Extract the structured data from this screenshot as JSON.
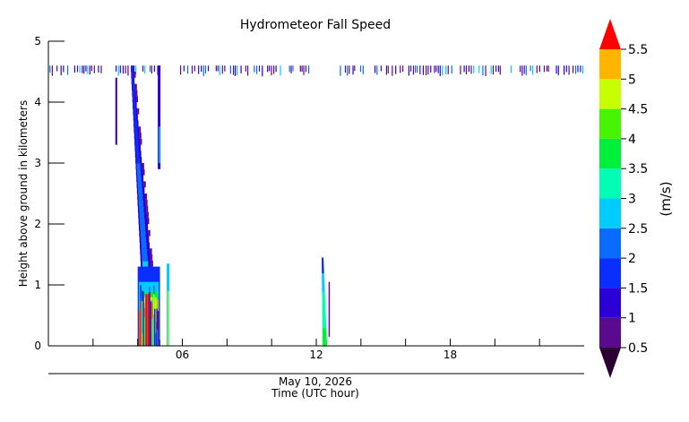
{
  "chart_data": {
    "type": "heatmap",
    "title": "Hydrometeor Fall Speed",
    "ylabel": "Height above ground in kilometers",
    "xlabel": "Time (UTC hour)",
    "date_label": "May 10, 2026",
    "colorbar_label": "(m/s)",
    "xlim": [
      0,
      24
    ],
    "ylim": [
      0,
      5
    ],
    "x_ticks": [
      {
        "value": 6,
        "label": "06"
      },
      {
        "value": 12,
        "label": "12"
      },
      {
        "value": 18,
        "label": "18"
      }
    ],
    "x_minor_ticks": [
      2,
      4,
      8,
      10,
      14,
      16,
      20,
      22
    ],
    "y_ticks": [
      {
        "value": 0,
        "label": "0"
      },
      {
        "value": 1,
        "label": "1"
      },
      {
        "value": 2,
        "label": "2"
      },
      {
        "value": 3,
        "label": "3"
      },
      {
        "value": 4,
        "label": "4"
      },
      {
        "value": 5,
        "label": "5"
      }
    ],
    "colorbar": {
      "levels": [
        0.5,
        1,
        1.5,
        2,
        2.5,
        3,
        3.5,
        4,
        4.5,
        5,
        5.5
      ],
      "labels": [
        "0.5",
        "1",
        "1.5",
        "2",
        "2.5",
        "3",
        "3.5",
        "4",
        "4.5",
        "5",
        "5.5"
      ],
      "colors": [
        "#5a0a8c",
        "#2a00d6",
        "#0a2eff",
        "#0a6cff",
        "#00ccff",
        "#00ffb4",
        "#00f03c",
        "#46f500",
        "#c8ff00",
        "#ffb400",
        "#ff5000"
      ],
      "under_color": "#2d0032",
      "over_color": "#ff0000",
      "extend": "both"
    },
    "grid": false,
    "features": [
      {
        "name": "cloud-layer-4.5km",
        "x_range": [
          0,
          24
        ],
        "height": 4.55,
        "fall_speed": [
          0.5,
          2
        ]
      },
      {
        "name": "fall-streak-main",
        "x_range": [
          3.7,
          4.8
        ],
        "y_range": [
          0,
          4.5
        ],
        "fall_speed": [
          0.5,
          5.5
        ]
      },
      {
        "name": "fall-streak-upper",
        "x_range": [
          3.0,
          3.1
        ],
        "y_range": [
          3.3,
          4.4
        ],
        "fall_speed": [
          0.5,
          1.5
        ]
      },
      {
        "name": "fall-streak-mid",
        "x_range": [
          4.9,
          5.0
        ],
        "y_range": [
          2.9,
          4.6
        ],
        "fall_speed": [
          0.5,
          2.5
        ]
      },
      {
        "name": "precip-core",
        "x_range": [
          4.0,
          5.5
        ],
        "y_range": [
          0,
          1.4
        ],
        "fall_speed": [
          0.5,
          5.5
        ]
      },
      {
        "name": "precip-cell-12z",
        "x_range": [
          12.2,
          12.6
        ],
        "y_range": [
          0,
          1.45
        ],
        "fall_speed": [
          0.5,
          3.5
        ]
      }
    ]
  }
}
